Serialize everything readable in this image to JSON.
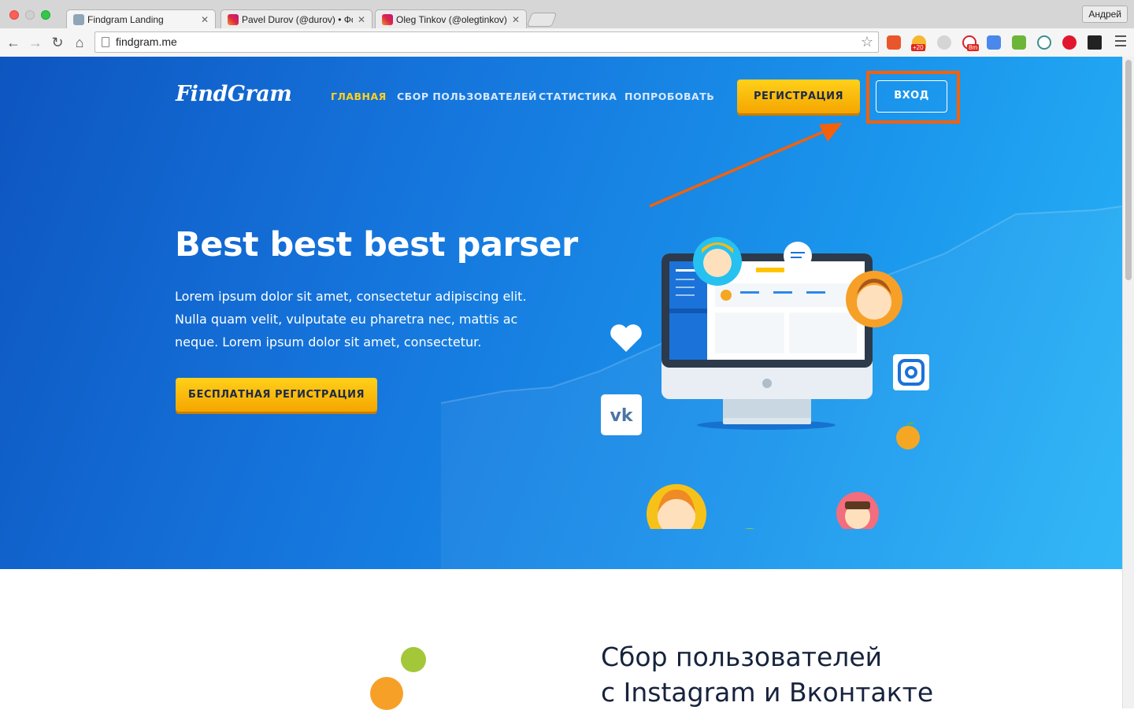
{
  "browser": {
    "tabs": [
      {
        "title": "Findgram Landing",
        "active": true
      },
      {
        "title": "Pavel Durov (@durov) • Фо",
        "active": false
      },
      {
        "title": "Oleg Tinkov (@olegtinkov)",
        "active": false
      }
    ],
    "profile_name": "Андрей",
    "url": "findgram.me",
    "extension_badges": {
      "ext2": "+20",
      "ext4": "8m"
    }
  },
  "site": {
    "logo": "FindGram",
    "nav": {
      "home": "ГЛАВНАЯ",
      "collect": "СБОР ПОЛЬЗОВАТЕЛЕЙ",
      "stats": "СТАТИСТИКА",
      "try": "ПОПРОБОВАТЬ"
    },
    "register_button": "РЕГИСТРАЦИЯ",
    "login_button": "ВХОД",
    "hero": {
      "title": "Best best best parser",
      "text": "Lorem ipsum dolor sit amet, consectetur adipiscing elit. Nulla quam velit, vulputate eu pharetra nec, mattis ac neque. Lorem ipsum dolor sit amet, consectetur.",
      "cta": "БЕСПЛАТНАЯ РЕГИСТРАЦИЯ"
    },
    "section2": {
      "title_line1": "Сбор пользователей",
      "title_line2": "с Instagram и Вконтакте"
    },
    "illustration_icons": [
      "heart-icon",
      "vk-icon",
      "instagram-icon",
      "chat-bubble-icon",
      "orange-icon",
      "monitor-icon"
    ]
  },
  "colors": {
    "accent_yellow": "#ffd11a",
    "hero_blue": "#1575dc",
    "annotation_orange": "#f4610b",
    "nav_active": "#ffd21f"
  }
}
